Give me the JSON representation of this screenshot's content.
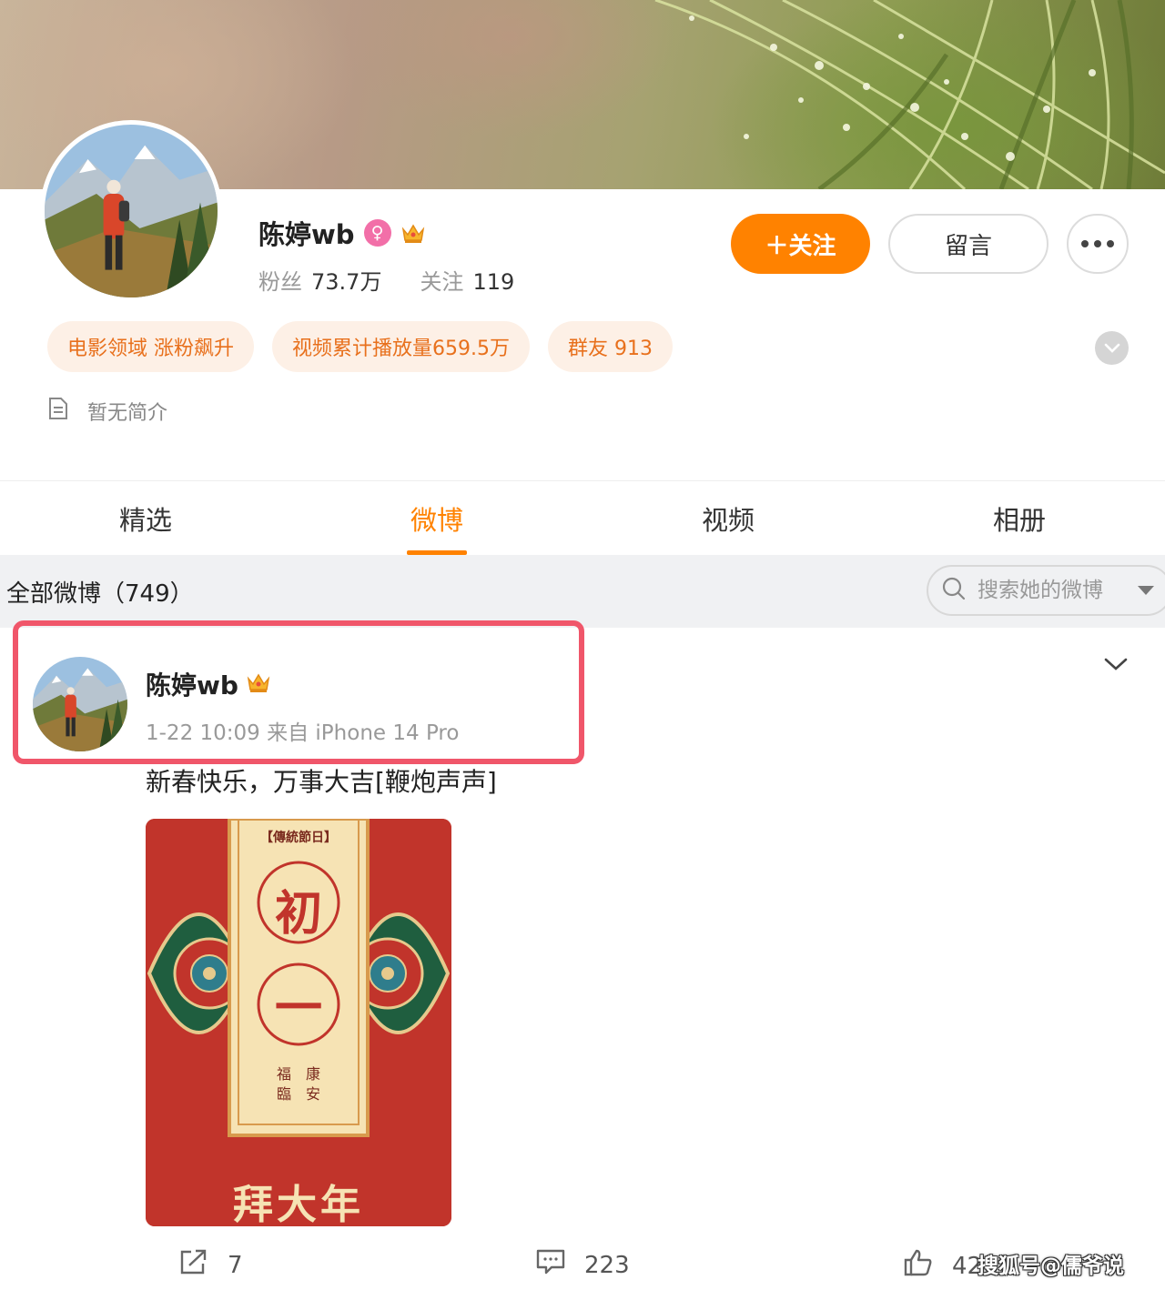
{
  "profile": {
    "name": "陈婷wb",
    "female_badge_icon": "female-symbol-icon",
    "vip_icon": "crown-icon",
    "fans_label": "粉丝",
    "fans_value": "73.7万",
    "following_label": "关注",
    "following_value": "119",
    "follow_button": "＋关注",
    "message_button": "留言",
    "more_icon": "more-dots-icon",
    "tags": [
      {
        "label": "电影领域 涨粉飙升"
      },
      {
        "label": "视频累计播放量659.5万"
      },
      {
        "label": "群友 913"
      }
    ],
    "expand_icon": "chevron-down-icon",
    "bio": "暂无简介",
    "bio_icon": "document-icon"
  },
  "tabs": [
    {
      "label": "精选",
      "active": false
    },
    {
      "label": "微博",
      "active": true
    },
    {
      "label": "视频",
      "active": false
    },
    {
      "label": "相册",
      "active": false
    }
  ],
  "filter": {
    "all_posts_label": "全部微博（749）",
    "search_placeholder": "搜索她的微博",
    "search_icon": "search-icon"
  },
  "post": {
    "author": "陈婷wb",
    "time": "1-22 10:09",
    "source": "来自 iPhone 14 Pro",
    "text": "新春快乐，万事大吉[鞭炮声声]",
    "image": {
      "top_label": "【傳統節日】",
      "char1": "初",
      "char2": "一",
      "blessing_left": "福臨",
      "blessing_right": "康安",
      "bottom_text": "拜大年"
    },
    "repost_count": "7",
    "comment_count": "223",
    "like_count": "42"
  },
  "watermark": "搜狐号@儒爷说",
  "colors": {
    "accent": "#ff8200",
    "tag_bg": "#fdf0e6",
    "tag_text": "#e8701c",
    "highlight": "#f0566a",
    "red_card": "#c1342b"
  }
}
